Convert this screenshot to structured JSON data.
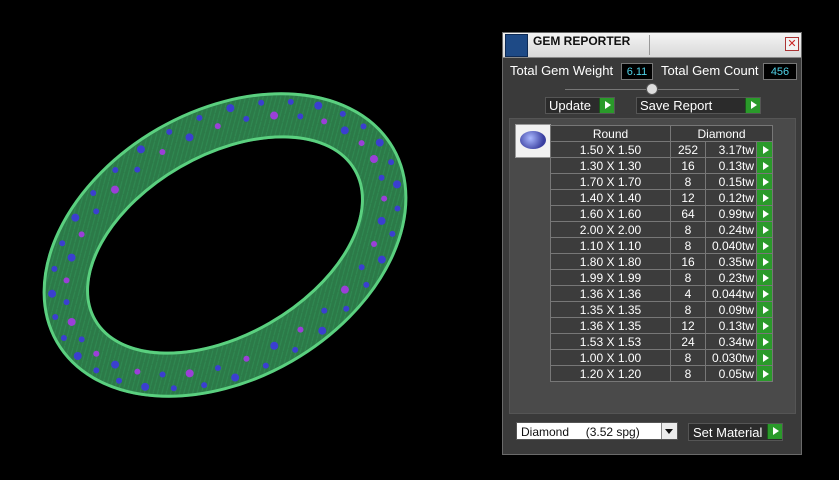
{
  "panel": {
    "title": "GEM REPORTER",
    "close_symbol": "✕",
    "total_weight_label": "Total Gem Weight",
    "total_weight_value": "6.11",
    "total_count_label": "Total Gem Count",
    "total_count_value": "456",
    "update_label": "Update",
    "save_label": "Save Report",
    "table_header_shape": "Round",
    "table_header_material": "Diamond",
    "rows": [
      {
        "size": "1.50 X 1.50",
        "count": "252",
        "tw": "3.17tw"
      },
      {
        "size": "1.30 X 1.30",
        "count": "16",
        "tw": "0.13tw"
      },
      {
        "size": "1.70 X 1.70",
        "count": "8",
        "tw": "0.15tw"
      },
      {
        "size": "1.40 X 1.40",
        "count": "12",
        "tw": "0.12tw"
      },
      {
        "size": "1.60 X 1.60",
        "count": "64",
        "tw": "0.99tw"
      },
      {
        "size": "2.00 X 2.00",
        "count": "8",
        "tw": "0.24tw"
      },
      {
        "size": "1.10 X 1.10",
        "count": "8",
        "tw": "0.040tw"
      },
      {
        "size": "1.80 X 1.80",
        "count": "16",
        "tw": "0.35tw"
      },
      {
        "size": "1.99 X 1.99",
        "count": "8",
        "tw": "0.23tw"
      },
      {
        "size": "1.36 X 1.36",
        "count": "4",
        "tw": "0.044tw"
      },
      {
        "size": "1.35 X 1.35",
        "count": "8",
        "tw": "0.09tw"
      },
      {
        "size": "1.36 X 1.35",
        "count": "12",
        "tw": "0.13tw"
      },
      {
        "size": "1.53 X 1.53",
        "count": "24",
        "tw": "0.34tw"
      },
      {
        "size": "1.00 X 1.00",
        "count": "8",
        "tw": "0.030tw"
      },
      {
        "size": "1.20 X 1.20",
        "count": "8",
        "tw": "0.05tw"
      }
    ],
    "material_select": "Diamond     (3.52 spg)",
    "set_material_label": "Set Material"
  },
  "colors": {
    "ring_green": "#4fc97a",
    "gem_blue": "#3b3fd0",
    "gem_purple": "#9b3fd8",
    "value_cyan": "#4fd1e6",
    "go_green": "#2a9a2a"
  }
}
